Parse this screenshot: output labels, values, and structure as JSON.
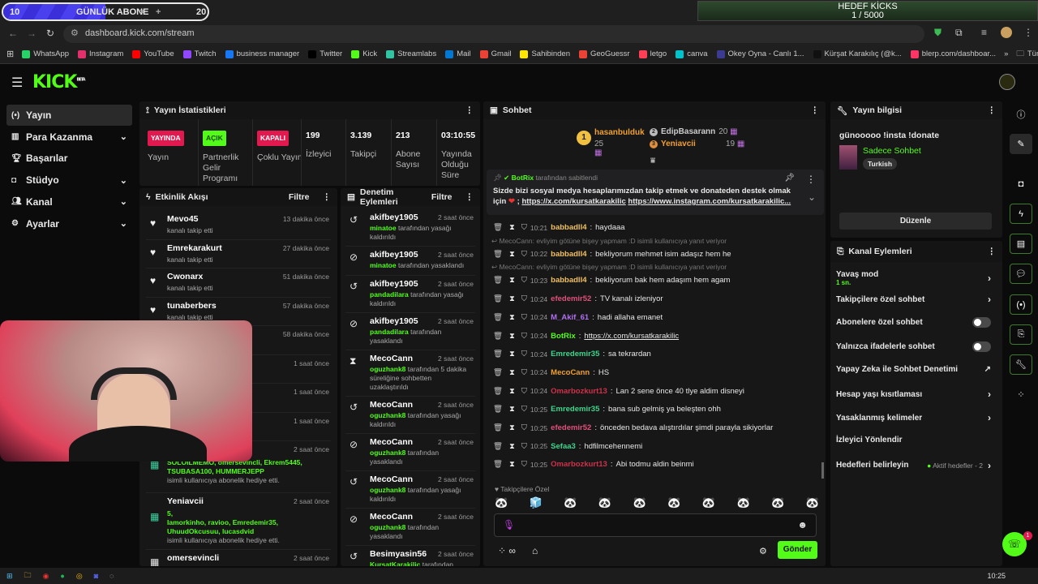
{
  "overlay": {
    "sub_goal_current": "10",
    "sub_goal_label": "GÜNLÜK ABONE",
    "sub_goal_target": "20",
    "sub_goal_progress": 0.5,
    "kicks_goal_title": "HEDEF KİCKS",
    "kicks_goal_value": "1 / 5000"
  },
  "browser": {
    "url": "dashboard.kick.com/stream",
    "bookmarks": [
      "WhatsApp",
      "Instagram",
      "YouTube",
      "Twitch",
      "business manager",
      "Twitter",
      "Kick",
      "Streamlabs",
      "Mail",
      "Gmail",
      "Sahibinden",
      "GeoGuessr",
      "letgo",
      "canva",
      "Okey Oyna - Canlı 1...",
      "Kürşat Karakılıç (@k...",
      "blerp.com/dashboar..."
    ],
    "all_bookmarks": "Tüm Yer İşaretleri",
    "colors": [
      "#25d366",
      "#e1306c",
      "#ff0000",
      "#9146ff",
      "#1877f2",
      "#000",
      "#53fc18",
      "#31c3a2",
      "#0078d4",
      "#ea4335",
      "#ffe600",
      "#ea4335",
      "#ff3f55",
      "#00c4cc",
      "#3b3b8f",
      "#111",
      "#ff3366"
    ]
  },
  "app": {
    "logo": "KICK",
    "beta": "BETA",
    "accent": "#53fc18"
  },
  "sidebar": {
    "items": [
      {
        "label": "Yayın",
        "icon": "(•)",
        "chev": false
      },
      {
        "label": "Para Kazanma",
        "icon": "▥",
        "chev": true
      },
      {
        "label": "Başarılar",
        "icon": "🏆︎",
        "chev": false
      },
      {
        "label": "Stüdyo",
        "icon": "◘",
        "chev": true
      },
      {
        "label": "Kanal",
        "icon": "👥︎",
        "chev": true
      },
      {
        "label": "Ayarlar",
        "icon": "⚙",
        "chev": true
      }
    ]
  },
  "stats": {
    "title": "Yayın İstatistikleri",
    "items": [
      {
        "badge": "YAYINDA",
        "badge_color": "#e1194f",
        "label": "Yayın"
      },
      {
        "badge": "AÇIK",
        "badge_color": "#53fc18",
        "label": "Partnerlik Gelir Programı"
      },
      {
        "badge": "KAPALI",
        "badge_color": "#e1194f",
        "label": "Çoklu Yayın"
      },
      {
        "value": "199",
        "label": "İzleyici"
      },
      {
        "value": "3.139",
        "label": "Takipçi"
      },
      {
        "value": "213",
        "label": "Abone Sayısı"
      },
      {
        "value": "03:10:55",
        "label": "Yayında Olduğu Süre"
      }
    ]
  },
  "activity": {
    "title": "Etkinlik Akışı",
    "filter": "Filtre",
    "items": [
      {
        "name": "Mevo45",
        "time": "13 dakika önce",
        "text": "kanalı takip etti"
      },
      {
        "name": "Emrekarakurt",
        "time": "27 dakika önce",
        "text": "kanalı takip etti"
      },
      {
        "name": "Cwonarx",
        "time": "51 dakika önce",
        "text": "kanalı takip etti"
      },
      {
        "name": "tunaberbers",
        "time": "57 dakika önce",
        "text": "kanalı takip etti"
      },
      {
        "name": "",
        "time": "58 dakika önce",
        "text": ""
      },
      {
        "name": "",
        "time": "1 saat önce",
        "text": ""
      },
      {
        "name": "",
        "time": "1 saat önce",
        "text": ""
      },
      {
        "name": "",
        "time": "1 saat önce",
        "text": ""
      }
    ],
    "gifts": [
      {
        "name": "",
        "time": "2 saat önce",
        "count": "5,",
        "users": "SOLOILMEMO, omersevincli, Ekrem5445, TSUBASA100, HUMMERJEPP",
        "text": "isimli kullanıcıya abonelik hediye etti."
      },
      {
        "name": "Yeniavcii",
        "time": "2 saat önce",
        "count": "5,",
        "users": "Iamorkinho, ravioo, Emredemir35, UhuudOkcusuu, lucasdvid",
        "text": "isimli kullanıcıya abonelik hediye etti."
      }
    ],
    "last": {
      "name": "omersevincli",
      "time": "2 saat önce"
    }
  },
  "moderation": {
    "title": "Denetim Eylemleri",
    "filter": "Filtre",
    "items": [
      {
        "icon": "unban",
        "name": "akifbey1905",
        "time": "2 saat önce",
        "by": "minatoe",
        "text": "tarafından yasağı kaldırıldı"
      },
      {
        "icon": "ban",
        "name": "akifbey1905",
        "time": "2 saat önce",
        "by": "minatoe",
        "text": "tarafından yasaklandı"
      },
      {
        "icon": "unban",
        "name": "akifbey1905",
        "time": "2 saat önce",
        "by": "pandadilara",
        "text": "tarafından yasağı kaldırıldı"
      },
      {
        "icon": "ban",
        "name": "akifbey1905",
        "time": "2 saat önce",
        "by": "pandadilara",
        "text": "tarafından yasaklandı"
      },
      {
        "icon": "timeout",
        "name": "MecoCann",
        "time": "2 saat önce",
        "by": "oguzhank8",
        "text": "tarafından 5 dakika süreliğine sohbetten uzaklaştırıldı"
      },
      {
        "icon": "unban",
        "name": "MecoCann",
        "time": "2 saat önce",
        "by": "oguzhank8",
        "text": "tarafından yasağı kaldırıldı"
      },
      {
        "icon": "ban",
        "name": "MecoCann",
        "time": "2 saat önce",
        "by": "oguzhank8",
        "text": "tarafından yasaklandı"
      },
      {
        "icon": "unban",
        "name": "MecoCann",
        "time": "2 saat önce",
        "by": "oguzhank8",
        "text": "tarafından yasağı kaldırıldı"
      },
      {
        "icon": "ban",
        "name": "MecoCann",
        "time": "2 saat önce",
        "by": "oguzhank8",
        "text": "tarafından yasaklandı"
      },
      {
        "icon": "unban",
        "name": "Besimyasin56",
        "time": "2 saat önce",
        "by": "KursatKarakilic",
        "text": "tarafından yasağı kaldırıldı"
      }
    ]
  },
  "chat": {
    "title": "Sohbet",
    "leaderboard": [
      {
        "rank": "1",
        "name": "hasanbulduk",
        "count": "25"
      },
      {
        "rank": "2",
        "name": "EdipBasarann",
        "count": "20"
      },
      {
        "rank": "3",
        "name": "Yeniavcii",
        "count": "19"
      }
    ],
    "pinned": {
      "by": "BotRix",
      "by_suffix": "tarafından sabitlendi",
      "text": "Sizde bizi sosyal medya hesaplarımızdan takip etmek ve donateden destek olmak için",
      "link1": "https://x.com/kursatkarakilic",
      "link2": "https://www.instagram.com/kursatkarakilic..."
    },
    "messages": [
      {
        "time": "10:21",
        "user": "babbadll4",
        "color": "#f0c060",
        "text": "haydaaa"
      },
      {
        "reply": "MecoCann: evliyim götüne bişey yapmam :D isimli kullanıcıya yanıt veriyor",
        "time": "10:22",
        "user": "babbadll4",
        "color": "#f0c060",
        "text": "bekliyorum mehmet isim adaşız hem he"
      },
      {
        "reply": "MecoCann: evliyim götüne bişey yapmam :D isimli kullanıcıya yanıt veriyor",
        "time": "10:23",
        "user": "babbadll4",
        "color": "#f0c060",
        "text": "bekliyorum bak hem adaşım hem agam"
      },
      {
        "time": "10:24",
        "user": "efedemir52",
        "color": "#e0507a",
        "text": "TV kanalı izleniyor"
      },
      {
        "time": "10:24",
        "user": "M_Akif_61",
        "color": "#b070f0",
        "text": "hadi allaha emanet"
      },
      {
        "time": "10:24",
        "user": "BotRix",
        "color": "#53fc18",
        "text": "https://x.com/kursatkarakilic",
        "link": true
      },
      {
        "time": "10:24",
        "user": "Emredemir35",
        "color": "#3cd68c",
        "text": "sa tekrardan"
      },
      {
        "time": "10:24",
        "user": "MecoCann",
        "color": "#f0a030",
        "text": "HS"
      },
      {
        "time": "10:24",
        "user": "Omarbozkurt13",
        "color": "#d0304a",
        "text": "Lan 2 sene önce 40 tlye aldim disneyi"
      },
      {
        "time": "10:25",
        "user": "Emredemir35",
        "color": "#3cd68c",
        "text": "bana sub gelmiş ya beleşten ohh"
      },
      {
        "time": "10:25",
        "user": "efedemir52",
        "color": "#e0507a",
        "text": "önceden bedava alıştırdılar şimdi parayla sikiyorlar"
      },
      {
        "time": "10:25",
        "user": "Sefaa3",
        "color": "#3cd68c",
        "text": "hdfilmcehennemi"
      },
      {
        "time": "10:25",
        "user": "Omarbozkurt13",
        "color": "#d0304a",
        "text": "Abi todmu aldin beinmi"
      }
    ],
    "emote_label": "Takipçilere Özel",
    "send": "Gönder"
  },
  "info": {
    "title": "Yayın bilgisi",
    "stream_title": "günooooo !insta !donate",
    "category": "Sadece Sohbet",
    "language": "Turkish",
    "edit": "Düzenle"
  },
  "actions": {
    "title": "Kanal Eylemleri",
    "items": [
      {
        "label": "Yavaş mod",
        "sub": "1 sn.",
        "type": "chevron"
      },
      {
        "label": "Takipçilere özel sohbet",
        "type": "chevron"
      },
      {
        "label": "Abonelere özel sohbet",
        "type": "toggle"
      },
      {
        "label": "Yalnızca ifadelerle sohbet",
        "type": "toggle"
      },
      {
        "label": "Yapay Zeka ile Sohbet Denetimi",
        "type": "external"
      },
      {
        "label": "Hesap yaşı kısıtlaması",
        "type": "chevron"
      },
      {
        "label": "Yasaklanmış kelimeler",
        "type": "chevron"
      },
      {
        "label": "İzleyici Yönlendir",
        "type": "none"
      },
      {
        "label": "Hedefleri belirleyin",
        "type": "chevron",
        "status": "Aktif hedefler - 2"
      }
    ]
  },
  "taskbar": {
    "clock": "10:25",
    "notification_count": "1"
  }
}
